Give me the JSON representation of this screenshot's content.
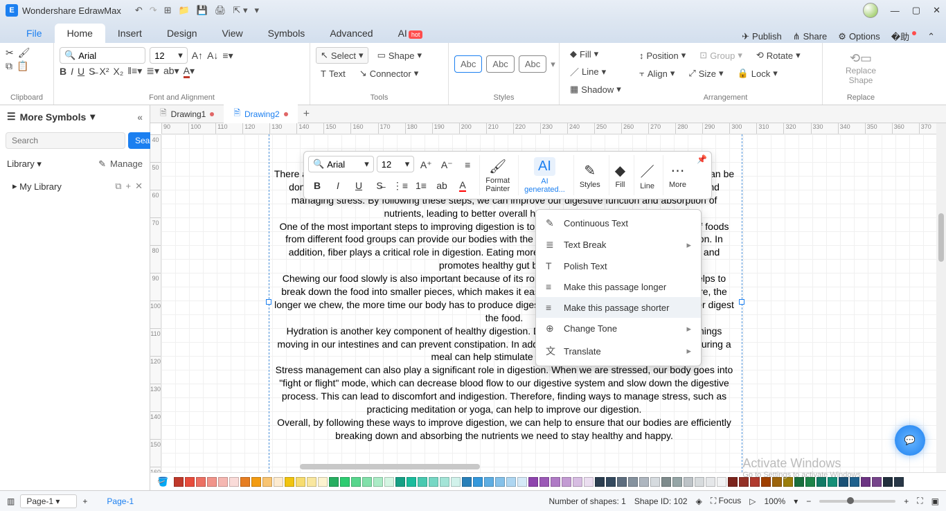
{
  "app": {
    "title": "Wondershare EdrawMax"
  },
  "menu": {
    "file": "File",
    "home": "Home",
    "insert": "Insert",
    "design": "Design",
    "view": "View",
    "symbols": "Symbols",
    "advanced": "Advanced",
    "ai": "AI",
    "hot": "hot",
    "publish": "Publish",
    "share": "Share",
    "options": "Options"
  },
  "ribbon": {
    "clipboard": "Clipboard",
    "fontalign": "Font and Alignment",
    "tools": "Tools",
    "styles": "Styles",
    "arrangement": "Arrangement",
    "replace": "Replace",
    "font": "Arial",
    "size": "12",
    "select": "Select",
    "shape": "Shape",
    "text": "Text",
    "connector": "Connector",
    "abc": "Abc",
    "fill": "Fill",
    "line": "Line",
    "shadow": "Shadow",
    "position": "Position",
    "group": "Group",
    "rotate": "Rotate",
    "align": "Align",
    "sizebtn": "Size",
    "lock": "Lock",
    "replace_shape": "Replace\nShape"
  },
  "left": {
    "more_symbols": "More Symbols",
    "search_ph": "Search",
    "search_btn": "Search",
    "library": "Library",
    "manage": "Manage",
    "mylib": "My Library"
  },
  "doctabs": {
    "d1": "Drawing1",
    "d2": "Drawing2"
  },
  "ruler_h": [
    "90",
    "100",
    "110",
    "120",
    "130",
    "140",
    "150",
    "160",
    "170",
    "180",
    "190",
    "200",
    "210",
    "220",
    "230",
    "240",
    "250",
    "260",
    "270",
    "280",
    "290",
    "300",
    "310",
    "320",
    "330",
    "340",
    "350",
    "360",
    "370"
  ],
  "ruler_v": [
    "40",
    "50",
    "60",
    "70",
    "80",
    "90",
    "100",
    "110",
    "120",
    "130",
    "140",
    "150",
    "160"
  ],
  "mini": {
    "font": "Arial",
    "size": "12",
    "format_painter": "Format\nPainter",
    "ai_gen": "AI\ngenerated...",
    "styles": "Styles",
    "fill": "Fill",
    "line": "Line",
    "more": "More"
  },
  "ctx": {
    "continuous": "Continuous Text",
    "break": "Text Break",
    "polish": "Polish Text",
    "longer": "Make this passage longer",
    "shorter": "Make this passage shorter",
    "tone": "Change Tone",
    "translate": "Translate"
  },
  "body": {
    "p1": "There are several ways to improve digestion that can help us feel better and improve digestion. This can be done by making certain changes to certain areas of our life such as eating, adding supplements, and managing stress. By following these steps, we can improve our digestive function and absorption of nutrients, leading to better overall health and well-being.",
    "p2": "One of the most important steps to improving digestion is to eat a balanced diet. Eating a variety of foods from different food groups can provide our bodies with the necessary nutrients for optimal digestion. In addition, fiber plays a critical role in digestion. Eating more fiber-rich foods helps keep us regular and promotes healthy gut bacteria.",
    "p3": "Chewing our food slowly is also important because of its role in the digestive process. Chewing helps to break down the food into smaller pieces, which makes it easier to absorb the nutrients. Furthermore, the longer we chew, the more time our body has to produce digestive enzymes, which can help us better digest the food.",
    "p4": "Hydration is another key component of healthy digestion. Drinking enough water can help keep things moving in our intestines and can prevent constipation. In addition, drinking warm liquids before or during a meal can help stimulate digestion.",
    "p5": "Stress management can also play a significant role in digestion. When we are stressed, our body goes into \"fight or flight\" mode, which can decrease blood flow to our digestive system and slow down the digestive process. This can lead to discomfort and indigestion. Therefore, finding ways to manage stress, such as practicing meditation or yoga, can help to improve our digestion.",
    "p6": "Overall, by following these ways to improve digestion, we can help to ensure that our bodies are efficiently breaking down and absorbing the nutrients we need to stay healthy and happy."
  },
  "status": {
    "page_sel": "Page-1",
    "page_active": "Page-1",
    "shapes": "Number of shapes: 1",
    "shapeid": "Shape ID: 102",
    "focus": "Focus",
    "zoom": "100%"
  },
  "watermark": {
    "l1": "Activate Windows",
    "l2": "Go to Settings to activate Windows."
  },
  "colors": [
    "#c0392b",
    "#e74c3c",
    "#ec7063",
    "#f1948a",
    "#f5b7b1",
    "#fadbd8",
    "#e67e22",
    "#f39c12",
    "#f8c471",
    "#fdebd0",
    "#f1c40f",
    "#f7dc6f",
    "#f9e79f",
    "#fcf3cf",
    "#27ae60",
    "#2ecc71",
    "#58d68d",
    "#82e0aa",
    "#abebc6",
    "#d5f5e3",
    "#16a085",
    "#1abc9c",
    "#48c9b0",
    "#76d7c4",
    "#a3e4d7",
    "#d1f2eb",
    "#2980b9",
    "#3498db",
    "#5dade2",
    "#85c1e9",
    "#aed6f1",
    "#d6eaf8",
    "#8e44ad",
    "#9b59b6",
    "#af7ac5",
    "#c39bd3",
    "#d7bde2",
    "#ebdef0",
    "#2c3e50",
    "#34495e",
    "#5d6d7e",
    "#85929e",
    "#aeb6bf",
    "#d6dbdf",
    "#7f8c8d",
    "#95a5a6",
    "#bdc3c7",
    "#d7dbdd",
    "#e5e7e9",
    "#f2f3f4",
    "#7b241c",
    "#943126",
    "#b03a2e",
    "#a04000",
    "#9c640c",
    "#9a7d0a",
    "#196f3d",
    "#1d8348",
    "#117a65",
    "#148f77",
    "#1a5276",
    "#1f618d",
    "#6c3483",
    "#76448a",
    "#212f3c",
    "#283747"
  ]
}
